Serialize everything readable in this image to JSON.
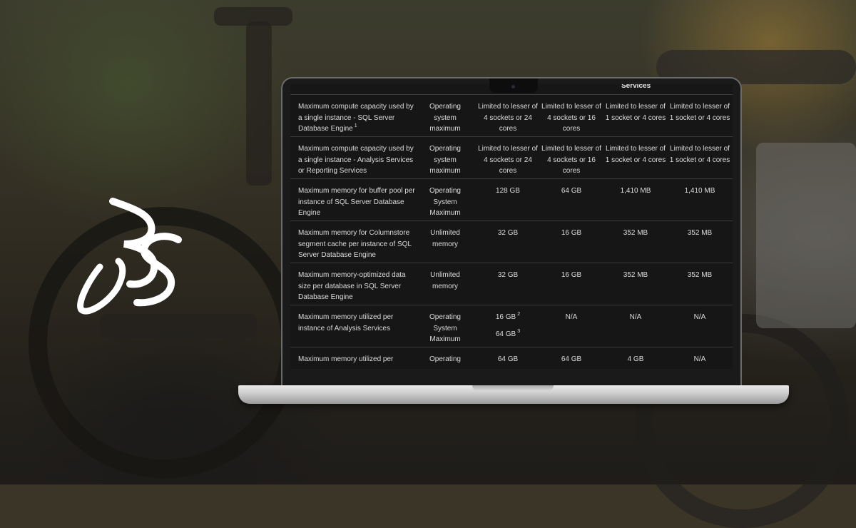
{
  "background": {
    "accent": "#ffffff",
    "scene": "electric motorcycle photo backdrop"
  },
  "logo": {
    "name": "3DS logo"
  },
  "table": {
    "header_partial": "Services",
    "rows": [
      {
        "feature": "Maximum compute capacity used by a single instance - SQL Server Database Engine",
        "feature_sup": "1",
        "col1": "Operating system maximum",
        "col2": "Limited to lesser of 4 sockets or 24 cores",
        "col3": "Limited to lesser of 4 sockets or 16 cores",
        "col4": "Limited to lesser of 1 socket or 4 cores",
        "col5": "Limited to lesser of 1 socket or 4 cores"
      },
      {
        "feature": "Maximum compute capacity used by a single instance - Analysis Services or Reporting Services",
        "col1": "Operating system maximum",
        "col2": "Limited to lesser of 4 sockets or 24 cores",
        "col3": "Limited to lesser of 4 sockets or 16 cores",
        "col4": "Limited to lesser of 1 socket or 4 cores",
        "col5": "Limited to lesser of 1 socket or 4 cores"
      },
      {
        "feature": "Maximum memory for buffer pool per instance of SQL Server Database Engine",
        "col1": "Operating System Maximum",
        "col2": "128 GB",
        "col3": "64 GB",
        "col4": "1,410 MB",
        "col5": "1,410 MB"
      },
      {
        "feature": "Maximum memory for Columnstore segment cache per instance of SQL Server Database Engine",
        "col1": "Unlimited memory",
        "col2": "32 GB",
        "col3": "16 GB",
        "col4": "352 MB",
        "col5": "352 MB"
      },
      {
        "feature": "Maximum memory-optimized data size per database in SQL Server Database Engine",
        "col1": "Unlimited memory",
        "col2": "32 GB",
        "col3": "16 GB",
        "col4": "352 MB",
        "col5": "352 MB"
      },
      {
        "feature": "Maximum memory utilized per instance of Analysis Services",
        "col1": "Operating System Maximum",
        "col2": "16 GB",
        "col2_sup": "2",
        "col2b": "64 GB",
        "col2b_sup": "3",
        "col3": "N/A",
        "col4": "N/A",
        "col5": "N/A"
      },
      {
        "feature": "Maximum memory utilized per",
        "col1": "Operating",
        "col2": "64 GB",
        "col3": "64 GB",
        "col4": "4 GB",
        "col5": "N/A"
      }
    ]
  }
}
